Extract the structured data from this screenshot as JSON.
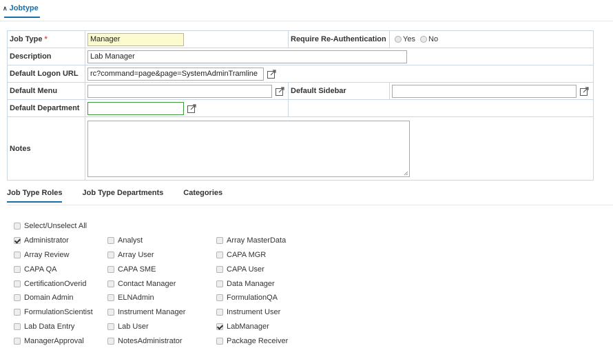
{
  "section": {
    "title": "Jobtype",
    "collapse_icon": "chevron-up-icon"
  },
  "form": {
    "job_type": {
      "label": "Job Type",
      "required_mark": "*",
      "value": "Manager"
    },
    "reauth": {
      "label": "Require Re-Authentication",
      "yes": "Yes",
      "no": "No",
      "selected": ""
    },
    "description": {
      "label": "Description",
      "value": "Lab Manager"
    },
    "logon_url": {
      "label": "Default Logon URL",
      "value": "rc?command=page&page=SystemAdminTramline"
    },
    "menu": {
      "label": "Default Menu",
      "value": ""
    },
    "sidebar": {
      "label": "Default Sidebar",
      "value": ""
    },
    "department": {
      "label": "Default Department",
      "value": ""
    },
    "notes": {
      "label": "Notes",
      "value": ""
    }
  },
  "tabs": [
    "Job Type Roles",
    "Job Type Departments",
    "Categories"
  ],
  "roles": {
    "select_all": "Select/Unselect All",
    "items": [
      {
        "label": "Administrator",
        "checked": true
      },
      {
        "label": "Analyst",
        "checked": false
      },
      {
        "label": "Array MasterData",
        "checked": false
      },
      {
        "label": "Array Review",
        "checked": false
      },
      {
        "label": "Array User",
        "checked": false
      },
      {
        "label": "CAPA MGR",
        "checked": false
      },
      {
        "label": "CAPA QA",
        "checked": false
      },
      {
        "label": "CAPA SME",
        "checked": false
      },
      {
        "label": "CAPA User",
        "checked": false
      },
      {
        "label": "CertificationOverid",
        "checked": false
      },
      {
        "label": "Contact Manager",
        "checked": false
      },
      {
        "label": "Data Manager",
        "checked": false
      },
      {
        "label": "Domain Admin",
        "checked": false
      },
      {
        "label": "ELNAdmin",
        "checked": false
      },
      {
        "label": "FormulationQA",
        "checked": false
      },
      {
        "label": "FormulationScientist",
        "checked": false
      },
      {
        "label": "Instrument Manager",
        "checked": false
      },
      {
        "label": "Instrument User",
        "checked": false
      },
      {
        "label": "Lab Data Entry",
        "checked": false
      },
      {
        "label": "Lab User",
        "checked": false
      },
      {
        "label": "LabManager",
        "checked": true
      },
      {
        "label": "ManagerApproval",
        "checked": false
      },
      {
        "label": "NotesAdministrator",
        "checked": false
      },
      {
        "label": "Package Receiver",
        "checked": false
      }
    ]
  },
  "colors": {
    "accent": "#1a6ea8",
    "required": "#d9534f",
    "highlight_field": "#fbfbcf",
    "focus_border": "#3c9a3c"
  }
}
